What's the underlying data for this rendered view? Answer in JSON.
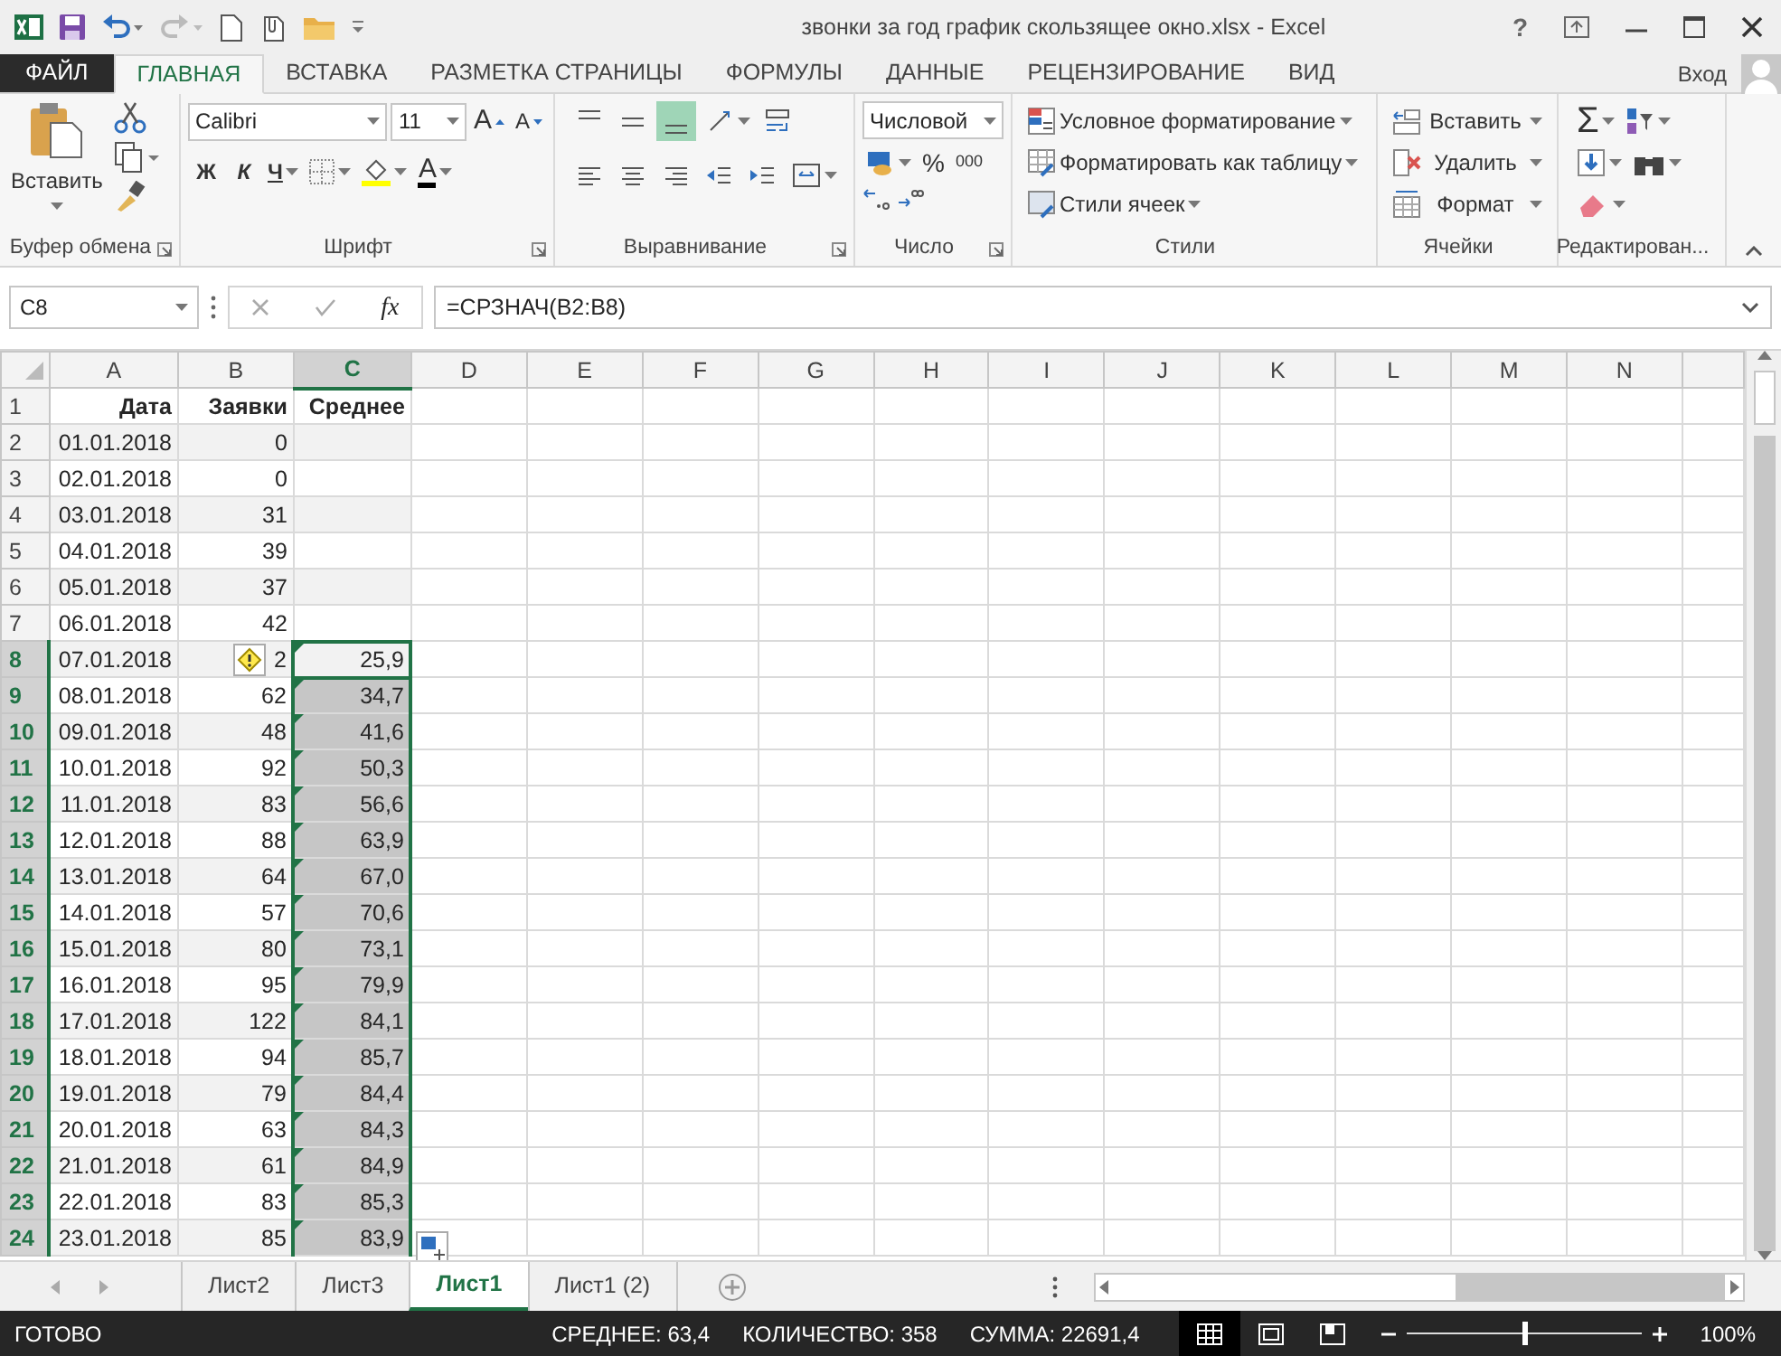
{
  "title_bar": {
    "title": "звонки за год график скользящее окно.xlsx - Excel",
    "help": "?"
  },
  "tabs": [
    {
      "label": "ФАЙЛ",
      "kind": "file",
      "selected": false
    },
    {
      "label": "ГЛАВНАЯ",
      "kind": "tab",
      "selected": true
    },
    {
      "label": "ВСТАВКА",
      "kind": "tab",
      "selected": false
    },
    {
      "label": "РАЗМЕТКА СТРАНИЦЫ",
      "kind": "tab",
      "selected": false
    },
    {
      "label": "ФОРМУЛЫ",
      "kind": "tab",
      "selected": false
    },
    {
      "label": "ДАННЫЕ",
      "kind": "tab",
      "selected": false
    },
    {
      "label": "РЕЦЕНЗИРОВАНИЕ",
      "kind": "tab",
      "selected": false
    },
    {
      "label": "ВИД",
      "kind": "tab",
      "selected": false
    }
  ],
  "account": {
    "label": "Вход"
  },
  "ribbon": {
    "clipboard": {
      "paste": "Вставить",
      "label": "Буфер обмена"
    },
    "font": {
      "name": "Calibri",
      "size": "11",
      "grow": "A",
      "shrink": "A",
      "bold": "Ж",
      "italic": "К",
      "underline": "Ч",
      "font_color": "A",
      "label": "Шрифт"
    },
    "alignment": {
      "label": "Выравнивание",
      "buttons": [
        {
          "kind": "top",
          "selected": false
        },
        {
          "kind": "middle",
          "selected": false
        },
        {
          "kind": "bottom",
          "selected": true
        },
        {
          "kind": "orientation",
          "selected": false
        },
        {
          "kind": "wrap",
          "selected": false
        },
        {
          "kind": "left",
          "selected": false
        },
        {
          "kind": "center",
          "selected": false
        },
        {
          "kind": "right",
          "selected": false
        },
        {
          "kind": "outdent",
          "selected": false
        },
        {
          "kind": "indent",
          "selected": false
        },
        {
          "kind": "merge",
          "selected": false
        }
      ]
    },
    "number": {
      "format": "Числовой",
      "percent": "%",
      "thousands": "000",
      "label": "Число"
    },
    "styles": {
      "items": [
        "Условное форматирование",
        "Форматировать как таблицу",
        "Стили ячеек"
      ],
      "label": "Стили"
    },
    "cells": {
      "items": [
        "Вставить",
        "Удалить",
        "Формат"
      ],
      "label": "Ячейки"
    },
    "editing": {
      "sum": "Σ",
      "label": "Редактирован..."
    }
  },
  "formula_bar": {
    "name_box": "C8",
    "fx": "fx",
    "formula": "=СРЗНАЧ(B2:B8)"
  },
  "grid": {
    "columns": [
      {
        "label": "A",
        "selected": false
      },
      {
        "label": "B",
        "selected": false
      },
      {
        "label": "C",
        "selected": true
      },
      {
        "label": "D",
        "selected": false
      },
      {
        "label": "E",
        "selected": false
      },
      {
        "label": "F",
        "selected": false
      },
      {
        "label": "G",
        "selected": false
      },
      {
        "label": "H",
        "selected": false
      },
      {
        "label": "I",
        "selected": false
      },
      {
        "label": "J",
        "selected": false
      },
      {
        "label": "K",
        "selected": false
      },
      {
        "label": "L",
        "selected": false
      },
      {
        "label": "M",
        "selected": false
      },
      {
        "label": "N",
        "selected": false
      }
    ],
    "rows": [
      {
        "number": "1",
        "kind": "header",
        "selected": false,
        "cells": [
          "Дата",
          "Заявки",
          "Среднее"
        ]
      },
      {
        "number": "2",
        "selected": false,
        "banded": true,
        "cells": [
          "01.01.2018",
          "0",
          ""
        ]
      },
      {
        "number": "3",
        "selected": false,
        "banded": false,
        "cells": [
          "02.01.2018",
          "0",
          ""
        ]
      },
      {
        "number": "4",
        "selected": false,
        "banded": true,
        "cells": [
          "03.01.2018",
          "31",
          ""
        ]
      },
      {
        "number": "5",
        "selected": false,
        "banded": false,
        "cells": [
          "04.01.2018",
          "39",
          ""
        ]
      },
      {
        "number": "6",
        "selected": false,
        "banded": true,
        "cells": [
          "05.01.2018",
          "37",
          ""
        ]
      },
      {
        "number": "7",
        "selected": false,
        "banded": false,
        "cells": [
          "06.01.2018",
          "42",
          ""
        ]
      },
      {
        "number": "8",
        "selected": true,
        "banded": true,
        "active": true,
        "flagged": true,
        "warning": true,
        "cells": [
          "07.01.2018",
          "2",
          "25,9"
        ]
      },
      {
        "number": "9",
        "selected": true,
        "banded": false,
        "flagged": true,
        "cells": [
          "08.01.2018",
          "62",
          "34,7"
        ]
      },
      {
        "number": "10",
        "selected": true,
        "banded": true,
        "flagged": true,
        "cells": [
          "09.01.2018",
          "48",
          "41,6"
        ]
      },
      {
        "number": "11",
        "selected": true,
        "banded": false,
        "flagged": true,
        "cells": [
          "10.01.2018",
          "92",
          "50,3"
        ]
      },
      {
        "number": "12",
        "selected": true,
        "banded": true,
        "flagged": true,
        "cells": [
          "11.01.2018",
          "83",
          "56,6"
        ]
      },
      {
        "number": "13",
        "selected": true,
        "banded": false,
        "flagged": true,
        "cells": [
          "12.01.2018",
          "88",
          "63,9"
        ]
      },
      {
        "number": "14",
        "selected": true,
        "banded": true,
        "flagged": true,
        "cells": [
          "13.01.2018",
          "64",
          "67,0"
        ]
      },
      {
        "number": "15",
        "selected": true,
        "banded": false,
        "flagged": true,
        "cells": [
          "14.01.2018",
          "57",
          "70,6"
        ]
      },
      {
        "number": "16",
        "selected": true,
        "banded": true,
        "flagged": true,
        "cells": [
          "15.01.2018",
          "80",
          "73,1"
        ]
      },
      {
        "number": "17",
        "selected": true,
        "banded": false,
        "flagged": true,
        "cells": [
          "16.01.2018",
          "95",
          "79,9"
        ]
      },
      {
        "number": "18",
        "selected": true,
        "banded": true,
        "flagged": true,
        "cells": [
          "17.01.2018",
          "122",
          "84,1"
        ]
      },
      {
        "number": "19",
        "selected": true,
        "banded": false,
        "flagged": true,
        "cells": [
          "18.01.2018",
          "94",
          "85,7"
        ]
      },
      {
        "number": "20",
        "selected": true,
        "banded": true,
        "flagged": true,
        "cells": [
          "19.01.2018",
          "79",
          "84,4"
        ]
      },
      {
        "number": "21",
        "selected": true,
        "banded": false,
        "flagged": true,
        "cells": [
          "20.01.2018",
          "63",
          "84,3"
        ]
      },
      {
        "number": "22",
        "selected": true,
        "banded": true,
        "flagged": true,
        "cells": [
          "21.01.2018",
          "61",
          "84,9"
        ]
      },
      {
        "number": "23",
        "selected": true,
        "banded": false,
        "flagged": true,
        "cells": [
          "22.01.2018",
          "83",
          "85,3"
        ]
      },
      {
        "number": "24",
        "selected": true,
        "banded": true,
        "flagged": true,
        "paste_options": true,
        "cells": [
          "23.01.2018",
          "85",
          "83,9"
        ]
      }
    ]
  },
  "sheet_tabs": [
    {
      "label": "Лист2",
      "selected": false
    },
    {
      "label": "Лист3",
      "selected": false
    },
    {
      "label": "Лист1",
      "selected": true
    },
    {
      "label": "Лист1 (2)",
      "selected": false
    }
  ],
  "status_bar": {
    "ready": "ГОТОВО",
    "stats": [
      "СРЕДНЕЕ: 63,4",
      "КОЛИЧЕСТВО: 358",
      "СУММА: 22691,4"
    ],
    "views": [
      {
        "kind": "normal",
        "selected": true
      },
      {
        "kind": "layout",
        "selected": false
      },
      {
        "kind": "pagebreak",
        "selected": false
      }
    ],
    "zoom": {
      "level": 0.5,
      "label": "100%"
    }
  }
}
